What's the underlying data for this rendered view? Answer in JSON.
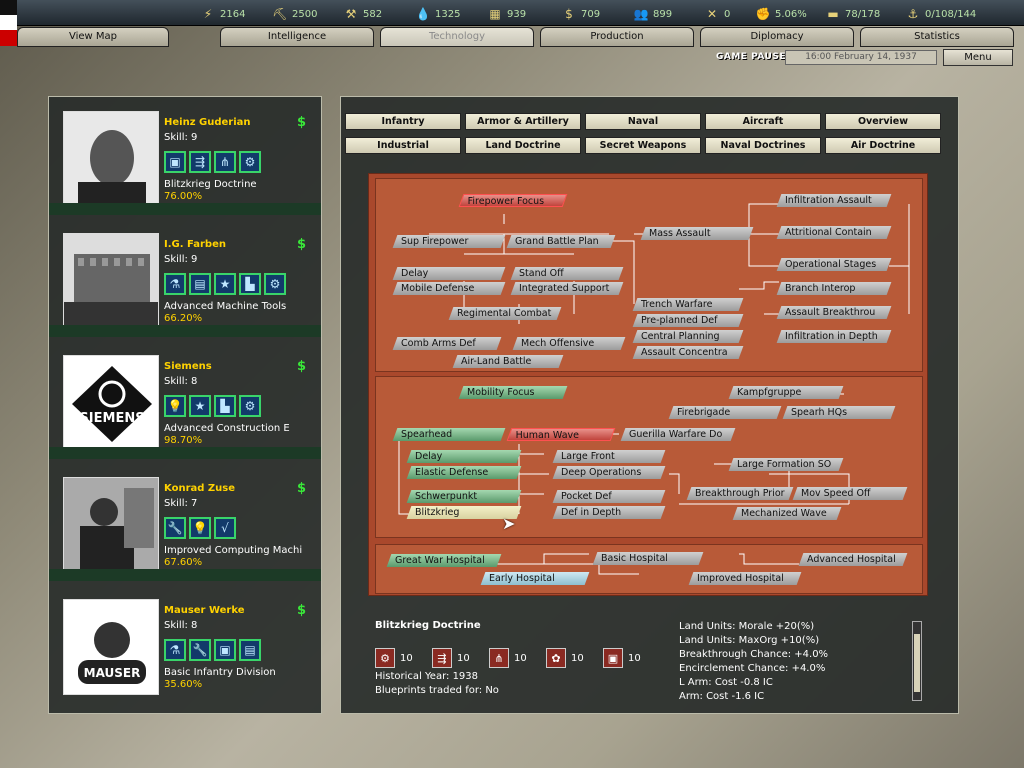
{
  "resources": [
    {
      "icon": "energy-icon",
      "glyph": "⚡",
      "value": "2164"
    },
    {
      "icon": "metal-icon",
      "glyph": "⛏",
      "value": "2500"
    },
    {
      "icon": "rare-materials-icon",
      "glyph": "⚒",
      "value": "582"
    },
    {
      "icon": "oil-icon",
      "glyph": "💧",
      "value": "1325"
    },
    {
      "icon": "supplies-icon",
      "glyph": "▦",
      "value": "939"
    },
    {
      "icon": "money-icon",
      "glyph": "$",
      "value": "709"
    },
    {
      "icon": "manpower-icon",
      "glyph": "👥",
      "value": "899"
    },
    {
      "icon": "crossed-swords-icon",
      "glyph": "✕",
      "value": "0"
    },
    {
      "icon": "dissent-icon",
      "glyph": "✊",
      "value": "5.06%"
    },
    {
      "icon": "transport-icon",
      "glyph": "▬",
      "value": "78/178"
    },
    {
      "icon": "convoy-icon",
      "glyph": "⚓",
      "value": "0/108/144"
    }
  ],
  "nav": [
    "View Map",
    "Intelligence",
    "Technology",
    "Production",
    "Diplomacy",
    "Statistics"
  ],
  "nav_active": "Technology",
  "status": {
    "paused": "GAME PAUSED",
    "date": "16:00 February 14, 1937",
    "menu": "Menu"
  },
  "teams": [
    {
      "name": "Heinz Guderian",
      "skill": "Skill: 9",
      "desc": "Blitzkrieg Doctrine",
      "pct": "76.00%",
      "icons": [
        "▣",
        "⇶",
        "⋔",
        "⚙"
      ]
    },
    {
      "name": "I.G. Farben",
      "skill": "Skill: 9",
      "desc": "Advanced Machine Tools",
      "pct": "66.20%",
      "icons": [
        "⚗",
        "▤",
        "★",
        "▙",
        "⚙"
      ]
    },
    {
      "name": "Siemens",
      "skill": "Skill: 8",
      "desc": "Advanced Construction E",
      "pct": "98.70%",
      "icons": [
        "💡",
        "★",
        "▙",
        "⚙"
      ]
    },
    {
      "name": "Konrad Zuse",
      "skill": "Skill: 7",
      "desc": "Improved Computing Machi",
      "pct": "67.60%",
      "icons": [
        "🔧",
        "💡",
        "√"
      ]
    },
    {
      "name": "Mauser Werke",
      "skill": "Skill: 8",
      "desc": "Basic Infantry Division",
      "pct": "35.60%",
      "icons": [
        "⚗",
        "🔧",
        "▣",
        "▤"
      ]
    }
  ],
  "tabs_row1": [
    "Infantry",
    "Armor & Artillery",
    "Naval",
    "Aircraft",
    "Overview"
  ],
  "tabs_row2": [
    "Industrial",
    "Land Doctrine",
    "Secret Weapons",
    "Naval Doctrines",
    "Air Doctrine"
  ],
  "tree": {
    "s1": [
      "Firepower Focus",
      "Sup Firepower",
      "Grand Battle Plan",
      "Mass Assault",
      "Delay",
      "Stand Off",
      "Mobile Defense",
      "Integrated Support",
      "Regimental Combat",
      "Comb Arms Def",
      "Mech Offensive",
      "Air-Land Battle",
      "Trench Warfare",
      "Pre-planned Def",
      "Central Planning",
      "Assault Concentra",
      "Infiltration Assault",
      "Attritional Contain",
      "Operational Stages",
      "Branch Interop",
      "Assault Breakthrou",
      "Infiltration in Depth"
    ],
    "s2": [
      "Mobility Focus",
      "Spearhead",
      "Human Wave",
      "Guerilla Warfare Do",
      "Delay",
      "Elastic Defense",
      "Schwerpunkt",
      "Blitzkrieg",
      "Large Front",
      "Deep Operations",
      "Pocket Def",
      "Def in Depth",
      "Kampfgruppe",
      "Firebrigade",
      "Spearh HQs",
      "Large Formation SO",
      "Breakthrough Prior",
      "Mov Speed Off",
      "Mechanized Wave"
    ],
    "s3": [
      "Great War Hospital",
      "Early Hospital",
      "Basic Hospital",
      "Improved Hospital",
      "Advanced Hospital"
    ]
  },
  "info": {
    "title": "Blitzkrieg Doctrine",
    "costs": [
      {
        "glyph": "⚙",
        "value": "10"
      },
      {
        "glyph": "⇶",
        "value": "10"
      },
      {
        "glyph": "⋔",
        "value": "10"
      },
      {
        "glyph": "✿",
        "value": "10"
      },
      {
        "glyph": "▣",
        "value": "10"
      }
    ],
    "year": "Historical Year: 1938",
    "blueprints": "Blueprints traded for: No",
    "effects": [
      "Land Units: Morale +20(%)",
      "Land Units: MaxOrg +10(%)",
      "Breakthrough Chance: +4.0%",
      "Encirclement Chance: +4.0%",
      "L Arm: Cost -0.8 IC",
      "Arm: Cost -1.6 IC"
    ]
  },
  "colors": {
    "tree_bg": "#a9482c",
    "team_name": "#ffd200",
    "accent_green": "#39e639"
  }
}
